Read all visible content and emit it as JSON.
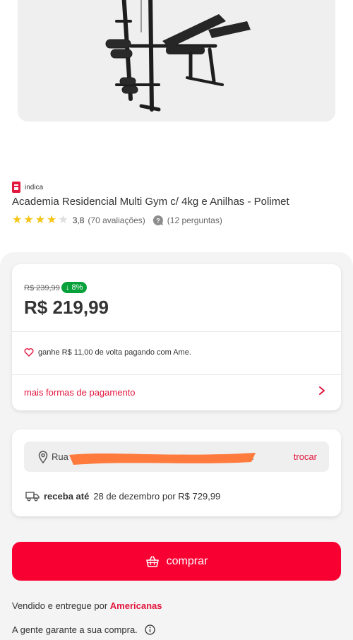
{
  "product": {
    "badge_text": "indica",
    "title": "Academia Residencial Multi Gym c/ 4kg e Anilhas - Polimet",
    "rating_value": "3,8",
    "rating_stars": 3.8,
    "reviews": "(70 avaliações)",
    "questions": "(12 perguntas)"
  },
  "price": {
    "old": "R$ 239,99",
    "discount": "↓ 8%",
    "current": "R$ 219,99",
    "cashback": "ganhe R$ 11,00 de volta pagando com Ame.",
    "more_payment": "mais formas de pagamento"
  },
  "shipping": {
    "address_prefix": "Rua",
    "address_suffix": "...",
    "change": "trocar",
    "receive_label": "receba até",
    "receive_detail": "28 de dezembro por R$ 729,99"
  },
  "buy_button": "comprar",
  "seller": {
    "prefix": "Vendido e entregue por",
    "name": "Americanas"
  },
  "guarantee": "A gente garante a sua compra.",
  "colors": {
    "accent": "#e3173e",
    "buy": "#f80032",
    "discount": "#06a13a",
    "star": "#f5c518",
    "redaction": "#ff7a3d"
  },
  "icons": [
    "heart-icon",
    "chevron-right-icon",
    "location-pin-icon",
    "truck-icon",
    "basket-icon",
    "info-icon",
    "question-bubble-icon"
  ]
}
